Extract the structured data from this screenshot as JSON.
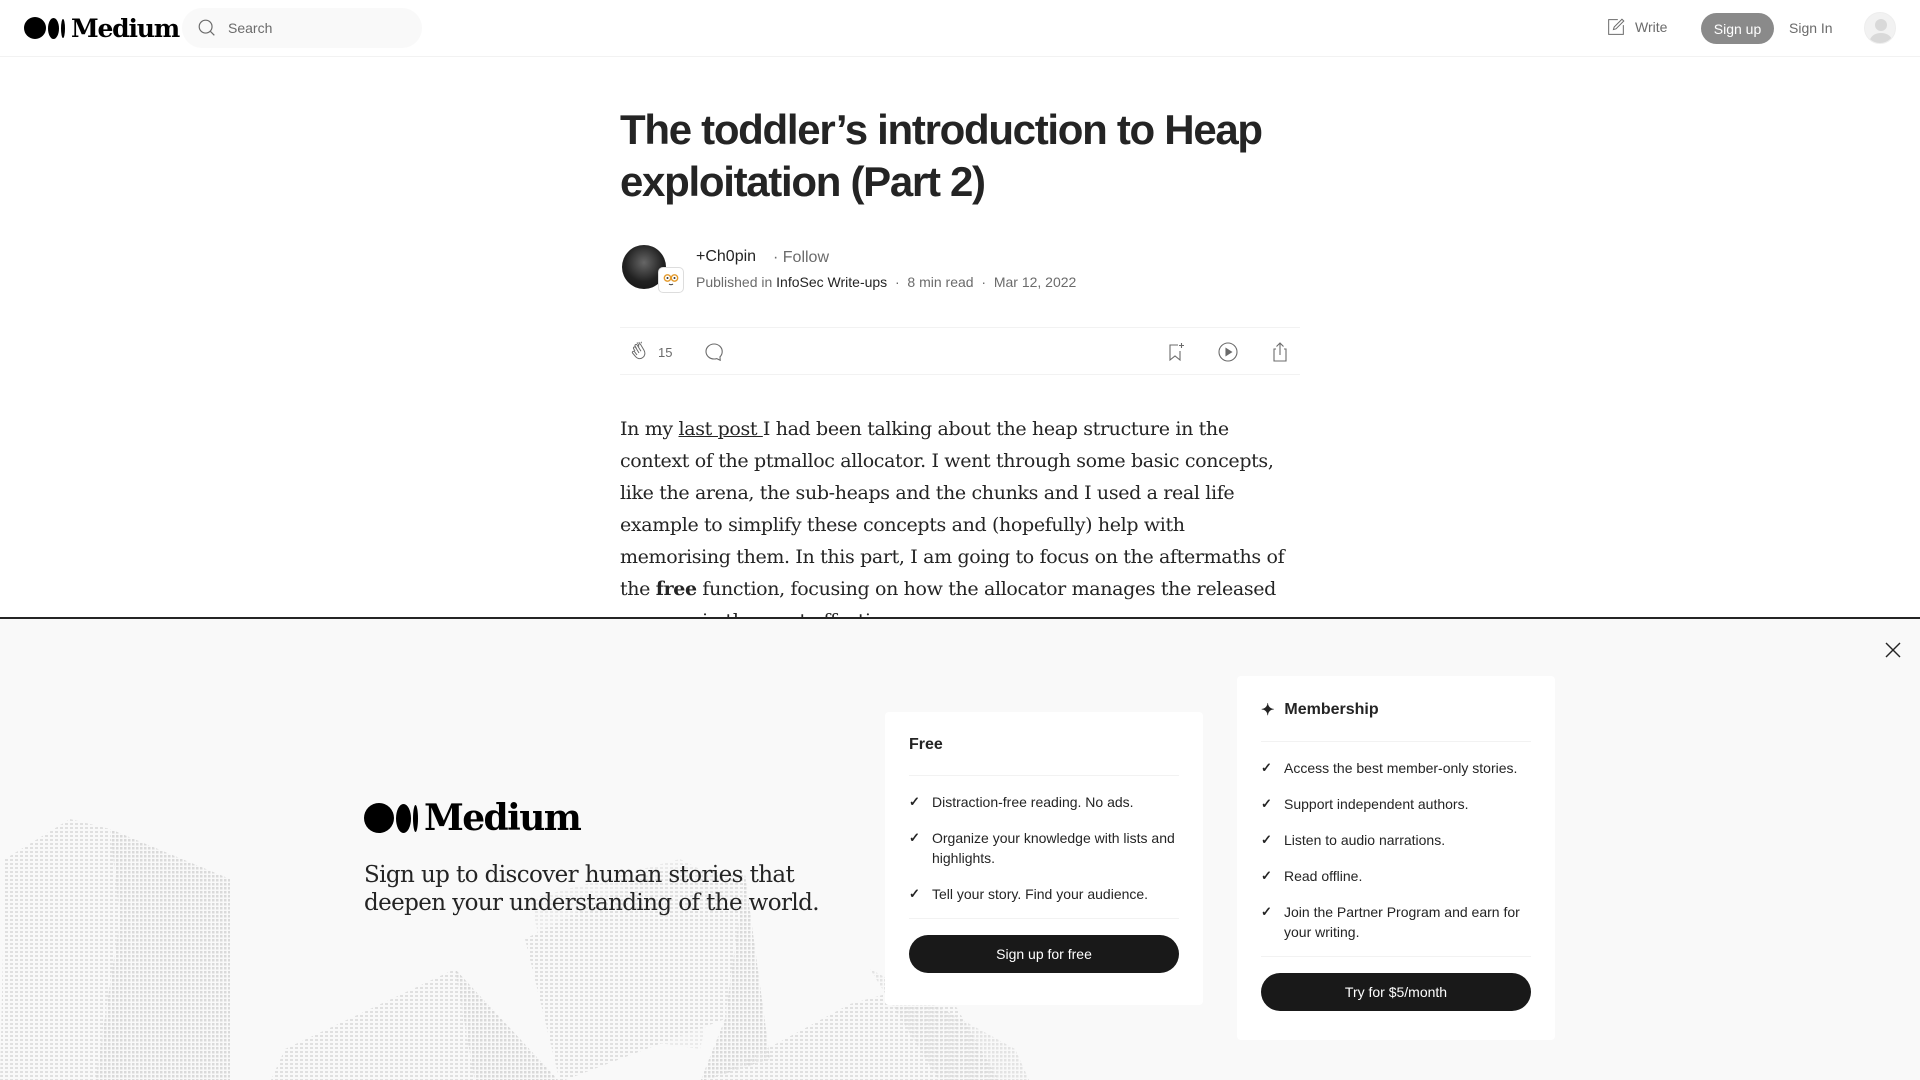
{
  "header": {
    "logo_text": "Medium",
    "search_placeholder": "Search",
    "write_label": "Write",
    "signup_label": "Sign up",
    "signin_label": "Sign In"
  },
  "article": {
    "title": "The toddler’s introduction to Heap exploitation (Part 2)",
    "author": "+Ch0pin",
    "follow_label": "· Follow",
    "published_in_label": "Published in",
    "publication": "InfoSec Write-ups",
    "read_time": "8 min read",
    "date": "Mar 12, 2022",
    "separator": "·",
    "claps": "15",
    "body": {
      "p1_before_link": "In my ",
      "link_text": "last post ",
      "p1_after_link": "I had been talking about the heap structure in the context of the ptmalloc allocator. I went through some basic concepts, like the arena, the sub-heaps and the chunks and I used a real life example to simplify these concepts and (hopefully) help with memorising them. In this part, I am going to focus on the aftermaths of the ",
      "bold_word": "free",
      "p1_end": " function, focusing on how the allocator manages the released memory in the most effective way."
    }
  },
  "signup_panel": {
    "logo_text": "Medium",
    "tagline": "Sign up to discover human stories that deepen your understanding of the world.",
    "free_card": {
      "title": "Free",
      "features": [
        "Distraction-free reading. No ads.",
        "Organize your knowledge with lists and highlights.",
        "Tell your story. Find your audience."
      ],
      "cta": "Sign up for free"
    },
    "membership_card": {
      "title": "Membership",
      "features": [
        "Access the best member-only stories.",
        "Support independent authors.",
        "Listen to audio narrations.",
        "Read offline.",
        "Join the Partner Program and earn for your writing."
      ],
      "cta": "Try for $5/month"
    },
    "check_glyph": "✓",
    "spark_glyph": "✦"
  }
}
